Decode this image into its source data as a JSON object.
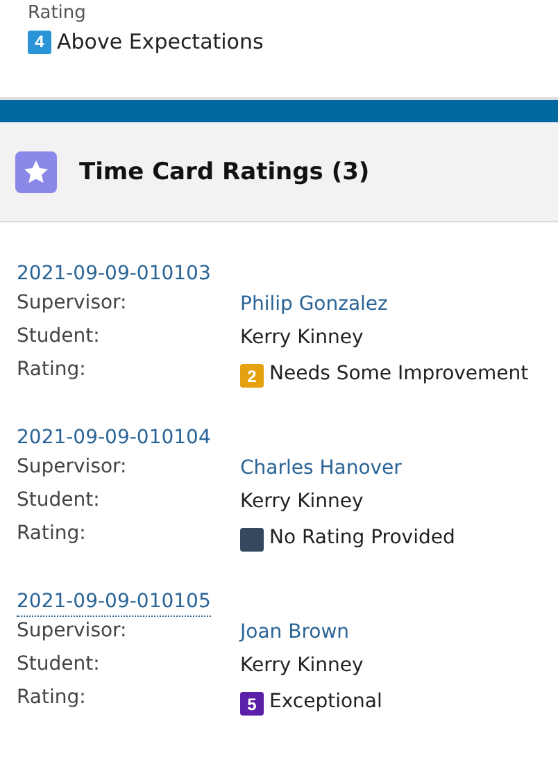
{
  "rating_field": {
    "label": "Rating",
    "badge": "4",
    "color": "#2a94d6",
    "value": "Above Expectations"
  },
  "related_list": {
    "title": "Time Card Ratings (3)",
    "records": [
      {
        "name": "2021-09-09-010103",
        "focused": false,
        "fields": [
          {
            "label": "Supervisor:",
            "kind": "link",
            "value": "Philip Gonzalez"
          },
          {
            "label": "Student:",
            "kind": "text",
            "value": "Kerry Kinney"
          },
          {
            "label": "Rating:",
            "kind": "rating",
            "badge": "2",
            "color": "#e5a10f",
            "value": "Needs Some Improvement"
          }
        ]
      },
      {
        "name": "2021-09-09-010104",
        "focused": false,
        "fields": [
          {
            "label": "Supervisor:",
            "kind": "link",
            "value": "Charles Hanover"
          },
          {
            "label": "Student:",
            "kind": "text",
            "value": "Kerry Kinney"
          },
          {
            "label": "Rating:",
            "kind": "rating",
            "color": "#34495e",
            "value": "No Rating Provided"
          }
        ]
      },
      {
        "name": "2021-09-09-010105",
        "focused": true,
        "fields": [
          {
            "label": "Supervisor:",
            "kind": "link",
            "value": "Joan Brown"
          },
          {
            "label": "Student:",
            "kind": "text",
            "value": "Kerry Kinney"
          },
          {
            "label": "Rating:",
            "kind": "rating",
            "badge": "5",
            "color": "#5b1fa8",
            "value": "Exceptional"
          }
        ]
      }
    ]
  }
}
